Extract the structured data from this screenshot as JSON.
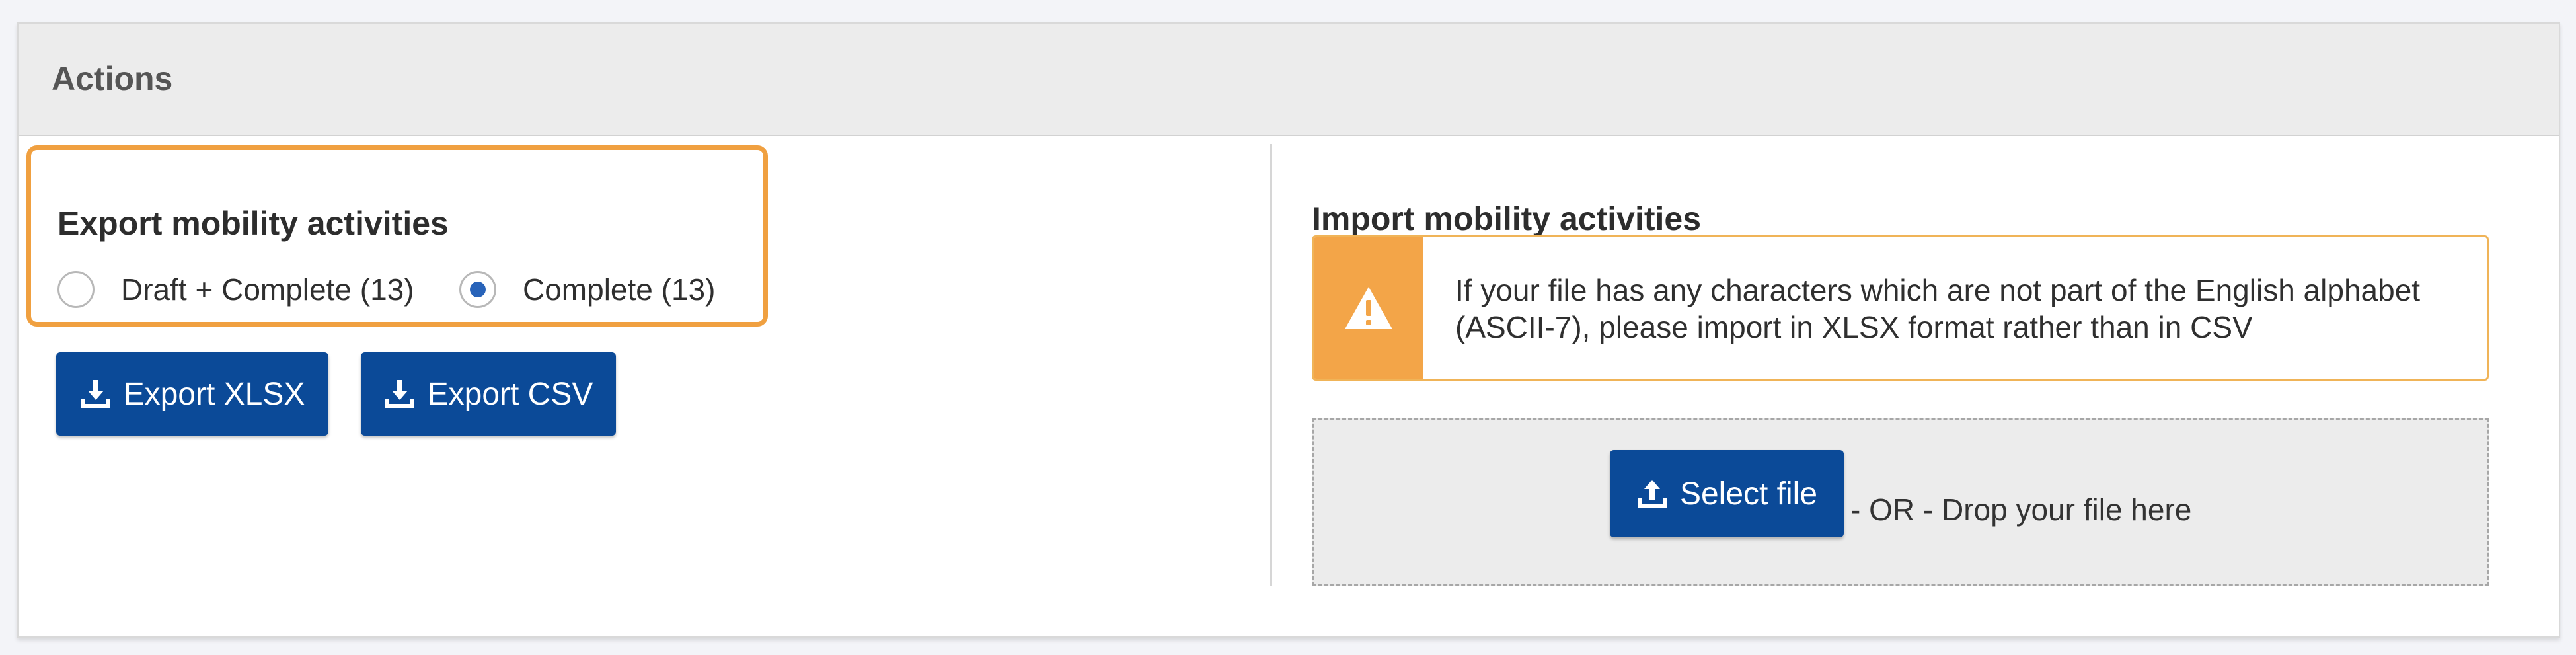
{
  "panel": {
    "title": "Actions"
  },
  "export": {
    "title": "Export mobility activities",
    "options": [
      {
        "label": "Draft + Complete (13)",
        "checked": false
      },
      {
        "label": "Complete (13)",
        "checked": true
      }
    ],
    "buttons": {
      "xlsx": {
        "label": "Export XLSX",
        "icon": "download-icon"
      },
      "csv": {
        "label": "Export CSV",
        "icon": "download-icon"
      }
    },
    "highlight_color": "#f0a040"
  },
  "import": {
    "title": "Import mobility activities",
    "warning": {
      "icon": "warning-icon",
      "text": "If your file has any characters which are not part of the English alphabet (ASCII-7), please import in XLSX format rather than in CSV",
      "accent_color": "#f3a548"
    },
    "select_button": {
      "label": "Select file",
      "icon": "upload-icon"
    },
    "drop_text": "- OR - Drop your file here"
  },
  "colors": {
    "primary_button": "#0b4a98",
    "radio_checked": "#2863b9"
  }
}
